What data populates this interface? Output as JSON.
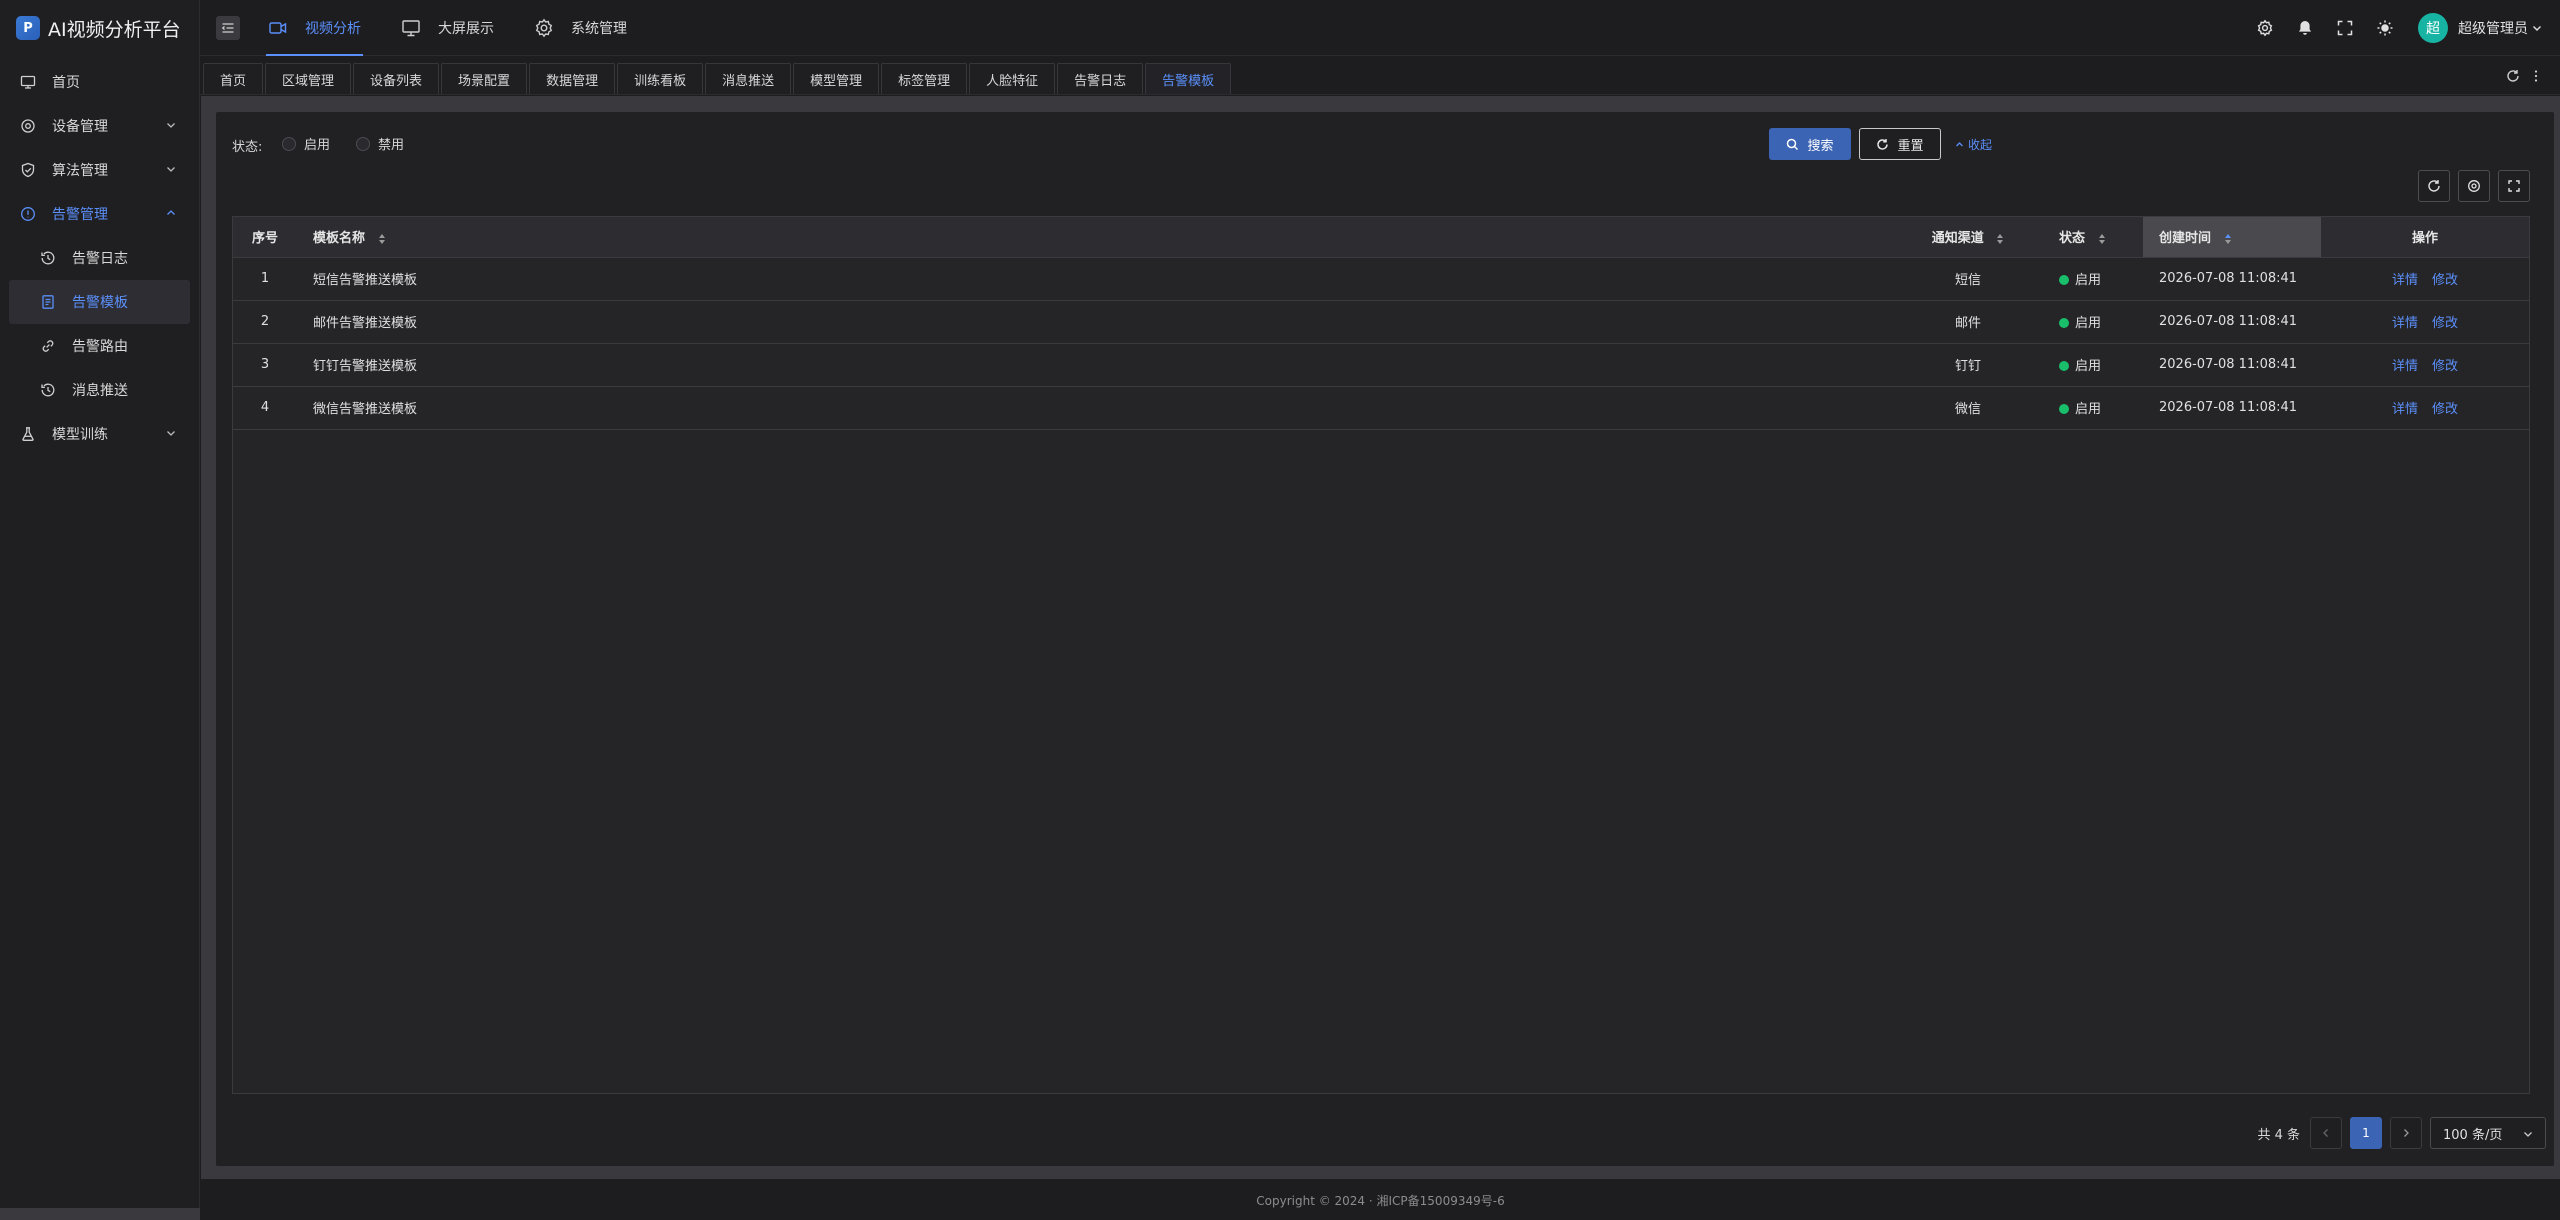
{
  "app": {
    "title": "AI视频分析平台",
    "logo_glyph": "P",
    "accent_color": "#5b8ff9",
    "primary_button_color": "#3c64b4",
    "enabled_status_color": "#19be6b"
  },
  "sidebar": {
    "items": [
      {
        "label": "首页",
        "icon": "monitor-icon"
      },
      {
        "label": "设备管理",
        "icon": "gear-icon",
        "expandable": true
      },
      {
        "label": "算法管理",
        "icon": "shield-icon",
        "expandable": true
      },
      {
        "label": "告警管理",
        "icon": "alert-circle-icon",
        "expandable": true,
        "open": true
      },
      {
        "label": "模型训练",
        "icon": "flask-icon",
        "expandable": true
      }
    ],
    "alarm_submenu": [
      {
        "label": "告警日志",
        "icon": "history-icon"
      },
      {
        "label": "告警模板",
        "icon": "document-icon",
        "active": true
      },
      {
        "label": "告警路由",
        "icon": "link-icon"
      },
      {
        "label": "消息推送",
        "icon": "history-icon"
      }
    ]
  },
  "header": {
    "nav": [
      {
        "label": "视频分析",
        "icon": "video-camera-icon",
        "active": true
      },
      {
        "label": "大屏展示",
        "icon": "monitor-icon"
      },
      {
        "label": "系统管理",
        "icon": "gear-icon"
      }
    ],
    "avatar_text": "超",
    "user_name": "超级管理员"
  },
  "tabs": [
    {
      "label": "首页"
    },
    {
      "label": "区域管理"
    },
    {
      "label": "设备列表"
    },
    {
      "label": "场景配置"
    },
    {
      "label": "数据管理"
    },
    {
      "label": "训练看板"
    },
    {
      "label": "消息推送"
    },
    {
      "label": "模型管理"
    },
    {
      "label": "标签管理"
    },
    {
      "label": "人脸特征"
    },
    {
      "label": "告警日志"
    },
    {
      "label": "告警模板",
      "active": true
    }
  ],
  "search": {
    "status_label": "状态:",
    "option_enabled": "启用",
    "option_disabled": "禁用",
    "search_label": "搜索",
    "reset_label": "重置",
    "collapse_label": "收起"
  },
  "table": {
    "columns": {
      "index": "序号",
      "name": "模板名称",
      "channel": "通知渠道",
      "status": "状态",
      "created": "创建时间",
      "ops": "操作"
    },
    "rows": [
      {
        "index": "1",
        "name": "短信告警推送模板",
        "channel": "短信",
        "status": "启用",
        "created": "2026-07-08 11:08:41",
        "detail": "详情",
        "edit": "修改"
      },
      {
        "index": "2",
        "name": "邮件告警推送模板",
        "channel": "邮件",
        "status": "启用",
        "created": "2026-07-08 11:08:41",
        "detail": "详情",
        "edit": "修改"
      },
      {
        "index": "3",
        "name": "钉钉告警推送模板",
        "channel": "钉钉",
        "status": "启用",
        "created": "2026-07-08 11:08:41",
        "detail": "详情",
        "edit": "修改"
      },
      {
        "index": "4",
        "name": "微信告警推送模板",
        "channel": "微信",
        "status": "启用",
        "created": "2026-07-08 11:08:41",
        "detail": "详情",
        "edit": "修改"
      }
    ]
  },
  "pagination": {
    "total": "共 4 条",
    "current_page": "1",
    "page_size": "100 条/页"
  },
  "footer": {
    "text": "Copyright © 2024 · 湘ICP备15009349号-6"
  }
}
